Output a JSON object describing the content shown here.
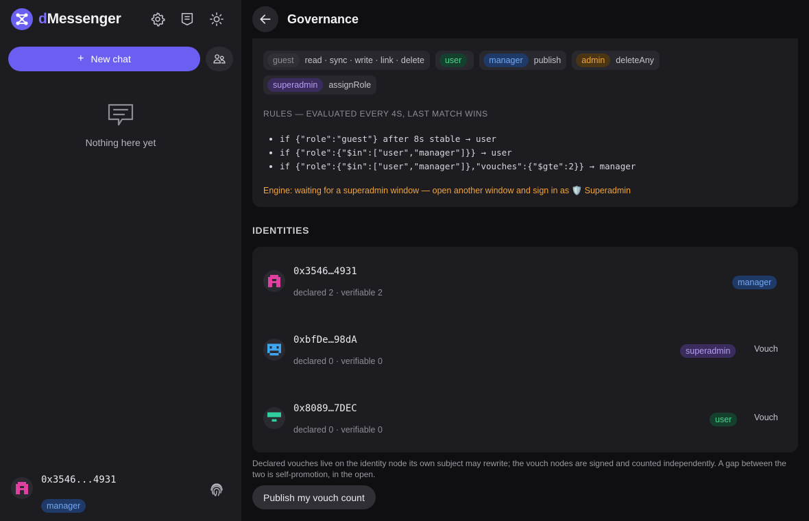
{
  "sidebar": {
    "brand_prefix": "d",
    "brand_rest": "Messenger",
    "new_chat_label": "New chat",
    "empty_text": "Nothing here yet",
    "me": {
      "address": "0x3546...4931",
      "role": "manager"
    }
  },
  "header": {
    "title": "Governance"
  },
  "permissions": [
    {
      "role": "guest",
      "actions": "read · sync · write · link · delete"
    },
    {
      "role": "user",
      "actions": ""
    },
    {
      "role": "manager",
      "actions": "publish"
    },
    {
      "role": "admin",
      "actions": "deleteAny"
    },
    {
      "role": "superadmin",
      "actions": "assignRole"
    }
  ],
  "rules": {
    "label": "RULES — EVALUATED EVERY 4S, LAST MATCH WINS",
    "items": [
      "if {\"role\":\"guest\"} after 8s stable → user",
      "if {\"role\":{\"$in\":[\"user\",\"manager\"]}} → user",
      "if {\"role\":{\"$in\":[\"user\",\"manager\"]},\"vouches\":{\"$gte\":2}} → manager"
    ]
  },
  "engine_note": "Engine: waiting for a superadmin window — open another window and sign in as 🛡️ Superadmin",
  "identities": {
    "title": "IDENTITIES",
    "items": [
      {
        "address": "0x3546…4931",
        "meta": "declared 2 · verifiable 2",
        "role": "manager",
        "vouch": ""
      },
      {
        "address": "0xbfDe…98dA",
        "meta": "declared 0 · verifiable 0",
        "role": "superadmin",
        "vouch": "Vouch"
      },
      {
        "address": "0x8089…7DEC",
        "meta": "declared 0 · verifiable 0",
        "role": "user",
        "vouch": "Vouch"
      }
    ]
  },
  "footnote": "Declared vouches live on the identity node its own subject may rewrite; the vouch nodes are signed and counted independently. A gap between the two is self-promotion, in the open.",
  "publish_label": "Publish my vouch count",
  "icons": {
    "logo": "network-logo-icon",
    "settings": "gear-icon",
    "notes": "document-icon",
    "theme": "sun-icon",
    "contacts": "users-icon",
    "empty": "chat-bubble-icon",
    "back": "arrow-left-icon",
    "fingerprint": "fingerprint-icon"
  },
  "colors": {
    "accent": "#6a5ff0",
    "sidebar_bg": "#1c1c21",
    "main_bg": "#0f0f12",
    "warning": "#f0a43a"
  }
}
